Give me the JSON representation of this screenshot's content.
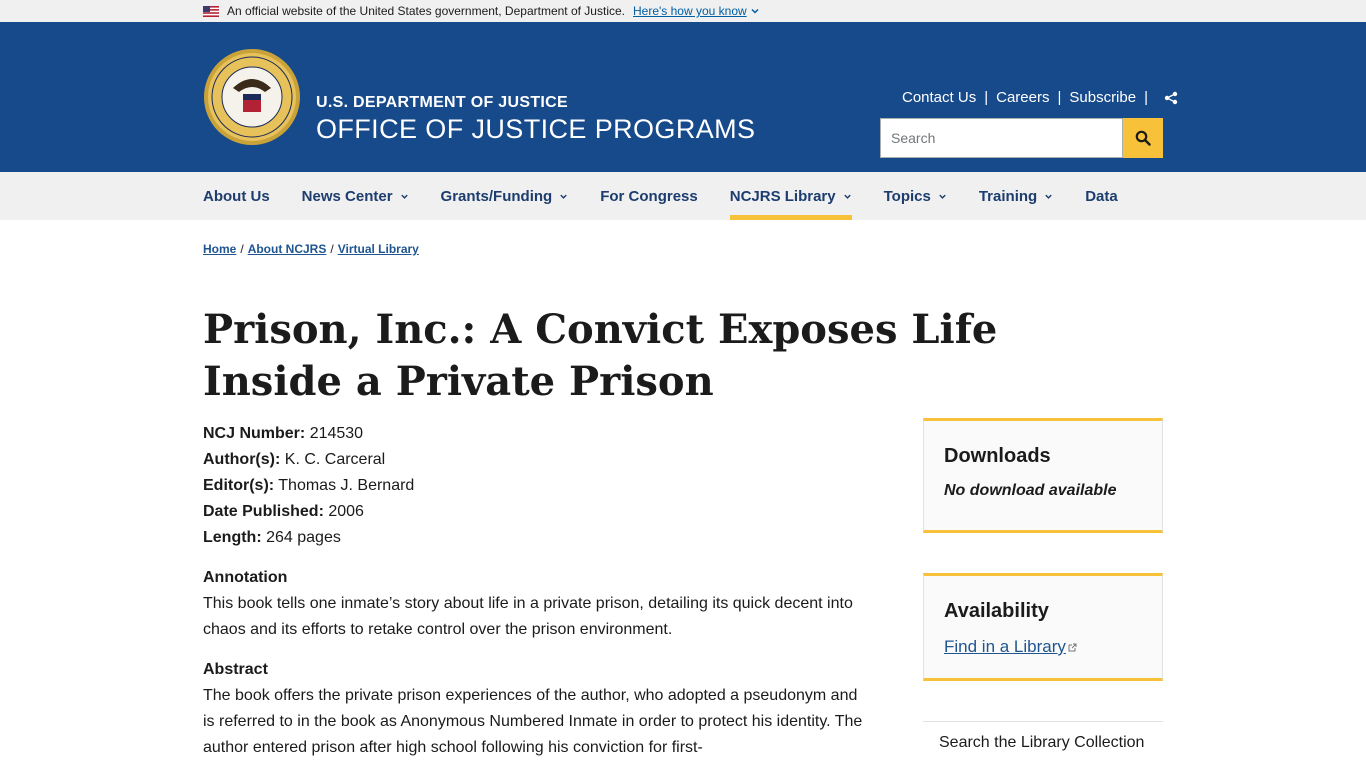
{
  "gov_banner": {
    "text": "An official website of the United States government, Department of Justice.",
    "link": "Here's how you know"
  },
  "header": {
    "dept": "U.S. DEPARTMENT OF JUSTICE",
    "office": "OFFICE OF JUSTICE PROGRAMS",
    "utility_links": [
      "Contact Us",
      "Careers",
      "Subscribe"
    ],
    "search_placeholder": "Search"
  },
  "nav": {
    "items": [
      {
        "label": "About Us"
      },
      {
        "label": "News Center"
      },
      {
        "label": "Grants/Funding"
      },
      {
        "label": "For Congress"
      },
      {
        "label": "NCJRS Library"
      },
      {
        "label": "Topics"
      },
      {
        "label": "Training"
      },
      {
        "label": "Data"
      }
    ]
  },
  "breadcrumb": [
    "Home",
    "About NCJRS",
    "Virtual Library"
  ],
  "title": "Prison, Inc.: A Convict Exposes Life Inside a Private Prison",
  "meta": {
    "ncj_label": "NCJ Number:",
    "ncj": "214530",
    "author_label": "Author(s):",
    "author": "K. C. Carceral",
    "editor_label": "Editor(s):",
    "editor": "Thomas J. Bernard",
    "date_label": "Date Published:",
    "date": "2006",
    "length_label": "Length:",
    "length": "264 pages"
  },
  "annotation": {
    "heading": "Annotation",
    "text": "This book tells one inmate’s story about life in a private prison, detailing its quick decent into chaos and its efforts to retake control over the prison environment."
  },
  "abstract": {
    "heading": "Abstract",
    "text": "The book offers the private prison experiences of the author, who adopted a pseudonym and is referred to in the book as Anonymous Numbered Inmate in order to protect his identity. The author entered prison after high school following his conviction for first-"
  },
  "sidebar": {
    "downloads_heading": "Downloads",
    "downloads_text": "No download available",
    "availability_heading": "Availability",
    "availability_link": "Find in a Library",
    "search_library": "Search the Library Collection"
  },
  "colors": {
    "header_blue": "#174a8b",
    "accent_gold": "#f8c13a",
    "link_blue": "#1f5590",
    "nav_text": "#1c3d6e"
  }
}
